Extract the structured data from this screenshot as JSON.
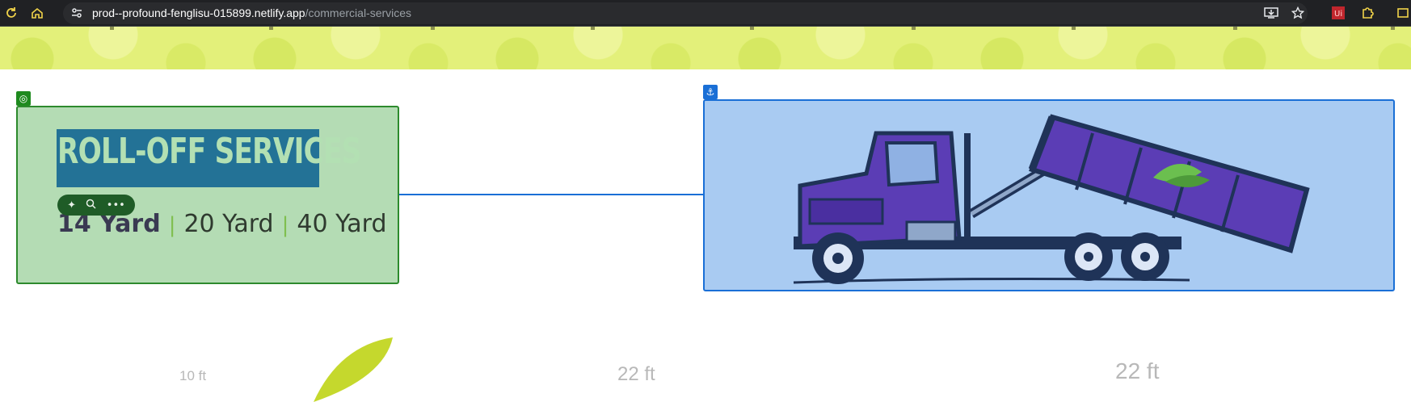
{
  "browser": {
    "url_host": "prod--profound-fenglisu-015899.netlify.app",
    "url_path": "/commercial-services",
    "icons": [
      "reload-icon",
      "home-icon",
      "site-settings-icon",
      "install-app-icon",
      "bookmark-star-icon",
      "extension-ui-icon",
      "extensions-puzzle-icon"
    ]
  },
  "hero": {
    "title": "ROLL-OFF SERVICES",
    "sizes": [
      "14 Yard",
      "20 Yard",
      "40 Yard"
    ],
    "separator": "|"
  },
  "editor_toolbar": {
    "icons": [
      "sparkle-icon",
      "search-icon",
      "more-icon"
    ]
  },
  "image": {
    "alt_subject": "roll-off truck illustration"
  },
  "dimensions": {
    "left": "10 ft",
    "middle": "22 ft",
    "right": "22 ft"
  },
  "colors": {
    "selection_green": "#2d8a2d",
    "selection_blue": "#1a6fd6",
    "banner": "#e3f07a",
    "title_highlight": "#237296"
  }
}
